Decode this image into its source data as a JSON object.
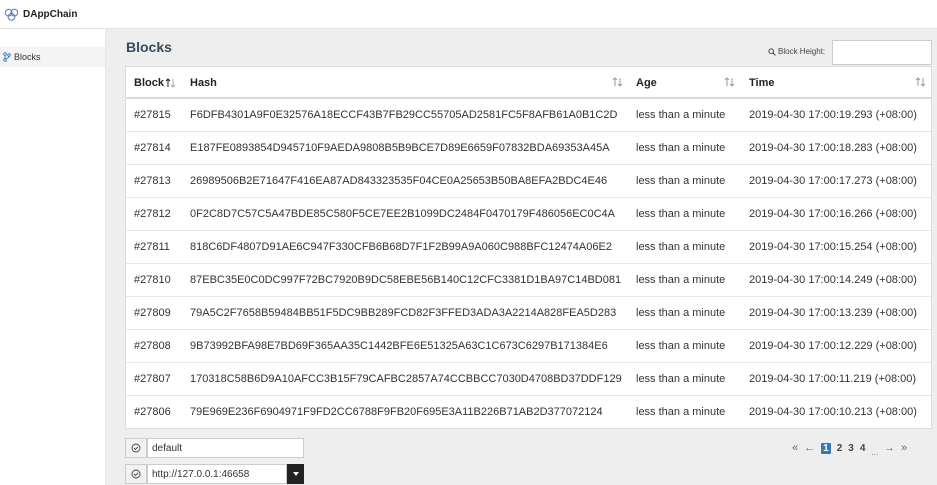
{
  "app": {
    "title": "DAppChain",
    "logo_icon": "infinity-logo-icon"
  },
  "sidebar": {
    "items": [
      {
        "label": "Blocks",
        "icon": "branch-icon"
      }
    ]
  },
  "main": {
    "title": "Blocks",
    "block_height": {
      "label": "Block Height:",
      "value": "",
      "icon": "search-icon"
    }
  },
  "table": {
    "headers": {
      "block": "Block",
      "hash": "Hash",
      "age": "Age",
      "time": "Time"
    },
    "rows": [
      {
        "block": "#27815",
        "hash": "F6DFB4301A9F0E32576A18ECCF43B7FB29CC55705AD2581FC5F8AFB61A0B1C2D",
        "age": "less than a minute",
        "time": "2019-04-30 17:00:19.293 (+08:00)"
      },
      {
        "block": "#27814",
        "hash": "E187FE0893854D945710F9AEDA9808B5B9BCE7D89E6659F07832BDA69353A45A",
        "age": "less than a minute",
        "time": "2019-04-30 17:00:18.283 (+08:00)"
      },
      {
        "block": "#27813",
        "hash": "26989506B2E71647F416EA87AD843323535F04CE0A25653B50BA8EFA2BDC4E46",
        "age": "less than a minute",
        "time": "2019-04-30 17:00:17.273 (+08:00)"
      },
      {
        "block": "#27812",
        "hash": "0F2C8D7C57C5A47BDE85C580F5CE7EE2B1099DC2484F0470179F486056EC0C4A",
        "age": "less than a minute",
        "time": "2019-04-30 17:00:16.266 (+08:00)"
      },
      {
        "block": "#27811",
        "hash": "818C6DF4807D91AE6C947F330CFB6B68D7F1F2B99A9A060C988BFC12474A06E2",
        "age": "less than a minute",
        "time": "2019-04-30 17:00:15.254 (+08:00)"
      },
      {
        "block": "#27810",
        "hash": "87EBC35E0C0DC997F72BC7920B9DC58EBE56B140C12CFC3381D1BA97C14BD081",
        "age": "less than a minute",
        "time": "2019-04-30 17:00:14.249 (+08:00)"
      },
      {
        "block": "#27809",
        "hash": "79A5C2F7658B59484BB51F5DC9BB289FCD82F3FFED3ADA3A2214A828FEA5D283",
        "age": "less than a minute",
        "time": "2019-04-30 17:00:13.239 (+08:00)"
      },
      {
        "block": "#27808",
        "hash": "9B73992BFA98E7BD69F365AA35C1442BFE6E51325A63C1C673C6297B171384E6",
        "age": "less than a minute",
        "time": "2019-04-30 17:00:12.229 (+08:00)"
      },
      {
        "block": "#27807",
        "hash": "170318C58B6D9A10AFCC3B15F79CAFBC2857A74CCBBCC7030D4708BD37DDF129",
        "age": "less than a minute",
        "time": "2019-04-30 17:00:11.219 (+08:00)"
      },
      {
        "block": "#27806",
        "hash": "79E969E236F6904971F9FD2CC6788F9FB20F695E3A11B226B71AB2D377072124",
        "age": "less than a minute",
        "time": "2019-04-30 17:00:10.213 (+08:00)"
      }
    ]
  },
  "footer": {
    "chain_id": {
      "value": "default"
    },
    "endpoint": {
      "value": "http://127.0.0.1:46658"
    }
  },
  "pagination": {
    "first": "«",
    "prev": "←",
    "next": "→",
    "last": "»",
    "pages": [
      "1",
      "2",
      "3",
      "4"
    ],
    "ellipsis": "...",
    "active": "1",
    "active_color": "#337ab7"
  }
}
